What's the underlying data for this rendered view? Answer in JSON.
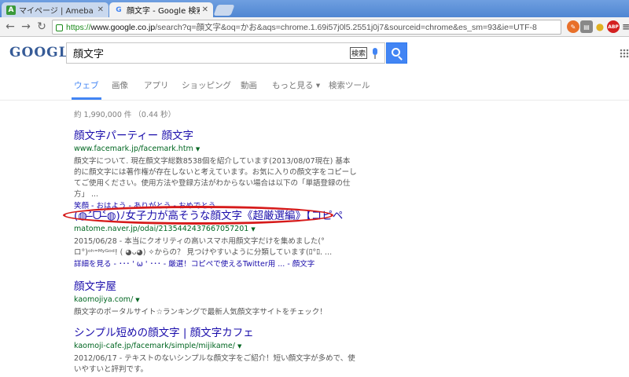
{
  "browser": {
    "tabs": [
      {
        "label": "マイページ | Ameba (アメー/",
        "active": false
      },
      {
        "label": "顔文字 - Google 検索",
        "active": true
      }
    ],
    "url": {
      "protocol": "https://",
      "host": "www.google.co.jp",
      "rest": "/search?q=顔文字&oq=かお&aqs=chrome.1.69i57j0l5.2551j0j7&sourceid=chrome&es_sm=93&ie=UTF-8"
    },
    "toolbar_icons": [
      "edit-icon",
      "reader-icon",
      "lightbulb-icon",
      "adblock-icon",
      "menu-icon"
    ],
    "adblock_label": "ABP"
  },
  "search": {
    "logo": "GOOGLE",
    "query": "顔文字",
    "keyboard_label": "検索"
  },
  "nav": {
    "tabs": [
      "ウェブ",
      "画像",
      "アプリ",
      "ショッピング",
      "動画",
      "もっと見る ▾",
      "検索ツール"
    ],
    "active_index": 0
  },
  "stats": "約 1,990,000 件 （0.44 秒）",
  "results": [
    {
      "title": "顔文字パーティー 顔文字",
      "url": "www.facemark.jp/facemark.htm",
      "snippet": "顔文字について. 現在顔文字総数8538個を紹介しています(2013/08/07現在) 基本的に顔文字には著作権が存在しないと考えています。お気に入りの顔文字をコピーしてご使用ください。使用方法や登録方法がわからない場合は以下の「単語登録の仕方」 ...",
      "links": "笑顔 - おはよう - ありがとう - おめでとう"
    },
    {
      "title": "(◍˃̶ᗜ˂̶◍)ﾉ女子力が高そうな顔文字《超厳選編》【コピペ",
      "url": "matome.naver.jp/odai/2135442437667057201",
      "snippet": "2015/06/28 - 本当にクオリティの高いスマホ用顔文字だけを集めました(°ロ°)ᵒʰ⁼ᴹʸᴳᵒᵈ! ( ◕ᴗ◕) ✧からの？ 見つけやすいように分類しています(ﾛ°ﾛ. ...",
      "links": "詳細を見る - ･･･ ' ω ' ･･･ - 厳選！コピペで使えるTwitter用 ... - 顔文字"
    },
    {
      "title": "顔文字屋",
      "url": "kaomojiya.com/",
      "snippet": "顔文字のポータルサイト☆ランキングで最新人気顔文字サイトをチェック！",
      "links": ""
    },
    {
      "title": "シンプル短めの顔文字 | 顔文字カフェ",
      "url": "kaomoji-cafe.jp/facemark/simple/mijikame/",
      "snippet": "2012/06/17 - テキストのないシンプルな顔文字をご紹介！短い顔文字が多めで、使いやすいと評判です。",
      "links": ""
    }
  ]
}
